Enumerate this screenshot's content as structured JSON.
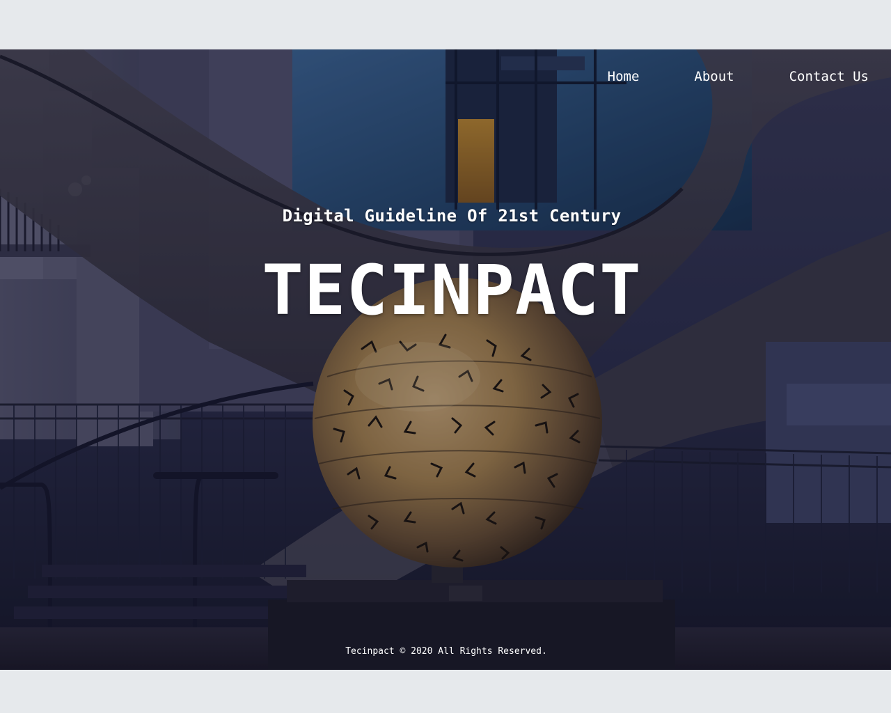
{
  "nav": {
    "items": [
      {
        "label": "Home"
      },
      {
        "label": "About"
      },
      {
        "label": "Contact Us"
      }
    ]
  },
  "hero": {
    "tagline": "Digital Guideline Of 21st Century",
    "brand": "TECINPACT",
    "image": "building-atrium-golden-sphere-sculpture"
  },
  "footer": {
    "copyright": "Tecinpact © 2020 All Rights Reserved."
  },
  "colors": {
    "page_background": "#e6e9ec",
    "text": "#ffffff",
    "sphere_gold": "#b08a4e",
    "night_blue": "#1a2140"
  }
}
